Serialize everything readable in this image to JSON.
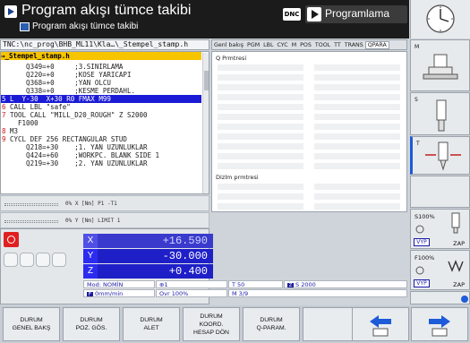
{
  "header": {
    "mode_title": "Program akışı tümce takibi",
    "mode_subtitle": "Program akışı tümce takibi",
    "dnc_label": "DNC",
    "second_mode": "Programlama"
  },
  "program": {
    "path": "TNC:\\nc_prog\\BHB_ML11\\Kla…\\_Stempel_stamp.h",
    "file_tab": "→_Stempel_stamp.h",
    "lines": [
      {
        "n": "",
        "text": "    Q349=+0     ;3.SINIRLAMA"
      },
      {
        "n": "",
        "text": "    Q220=+0     ;KOSE YARICAPI"
      },
      {
        "n": "",
        "text": "    Q368=+0     ;YAN OLCU"
      },
      {
        "n": "",
        "text": "    Q338=+0     ;KESME PERDAHL."
      },
      {
        "n": "5",
        "text": "L  Y-30  X+30 R0 FMAX M99"
      },
      {
        "n": "6",
        "text": "CALL LBL \"safe\""
      },
      {
        "n": "7",
        "text": "TOOL CALL \"MILL_D20_ROUGH\" Z S2000"
      },
      {
        "n": "",
        "text": "  F1000"
      },
      {
        "n": "8",
        "text": "M3"
      },
      {
        "n": "9",
        "text": "CYCL DEF 256 RECTANGULAR STUD"
      },
      {
        "n": "",
        "text": "    Q218=+30    ;1. YAN UZUNLUKLAR"
      },
      {
        "n": "",
        "text": "    Q424=+60    ;WORKPC. BLANK SIDE 1"
      },
      {
        "n": "",
        "text": "    Q219=+30    ;2. YAN UZUNLUKLAR"
      }
    ]
  },
  "info_rows": [
    {
      "text": "0% X [Nm]  P1  -T1"
    },
    {
      "text": "0% Y [Nm]  LIMIT 1"
    }
  ],
  "status_tabs": [
    "Genl bakış",
    "PGM",
    "LBL",
    "CYC",
    "M",
    "POS",
    "TOOL",
    "TT",
    "TRANS",
    "QPARA"
  ],
  "status_panel": {
    "q_params_label": "Q Prmtresi",
    "list_params_label": "Dizlm prmtresi"
  },
  "axes": [
    {
      "label": "X",
      "value": "+16.590"
    },
    {
      "label": "Y",
      "value": "-30.000"
    },
    {
      "label": "Z",
      "value": "+0.400"
    }
  ],
  "status": {
    "mode": "Mod: NOMİN",
    "feed": "0mm/min",
    "override": "Ovr 100%",
    "coord": "1",
    "tool": "T 50",
    "spindle": "S 2000",
    "m": "M 3/9"
  },
  "right_keys": {
    "m_label": "M",
    "s_label": "S",
    "t_label": "T"
  },
  "overrides": [
    {
      "pct": "S100%",
      "vyp": "VYP",
      "zap": "ZAP"
    },
    {
      "pct": "F100%",
      "vyp": "VYP",
      "zap": "ZAP"
    }
  ],
  "softkeys": [
    {
      "line1": "DURUM",
      "line2": "GENEL BAKŞ"
    },
    {
      "line1": "DURUM",
      "line2": "POZ. GÖS."
    },
    {
      "line1": "DURUM",
      "line2": "ALET"
    },
    {
      "line1": "DURUM",
      "line2": "KOORD.",
      "line3": "HESAP DÖN"
    },
    {
      "line1": "DURUM",
      "line2": "Q-PARAM."
    }
  ]
}
